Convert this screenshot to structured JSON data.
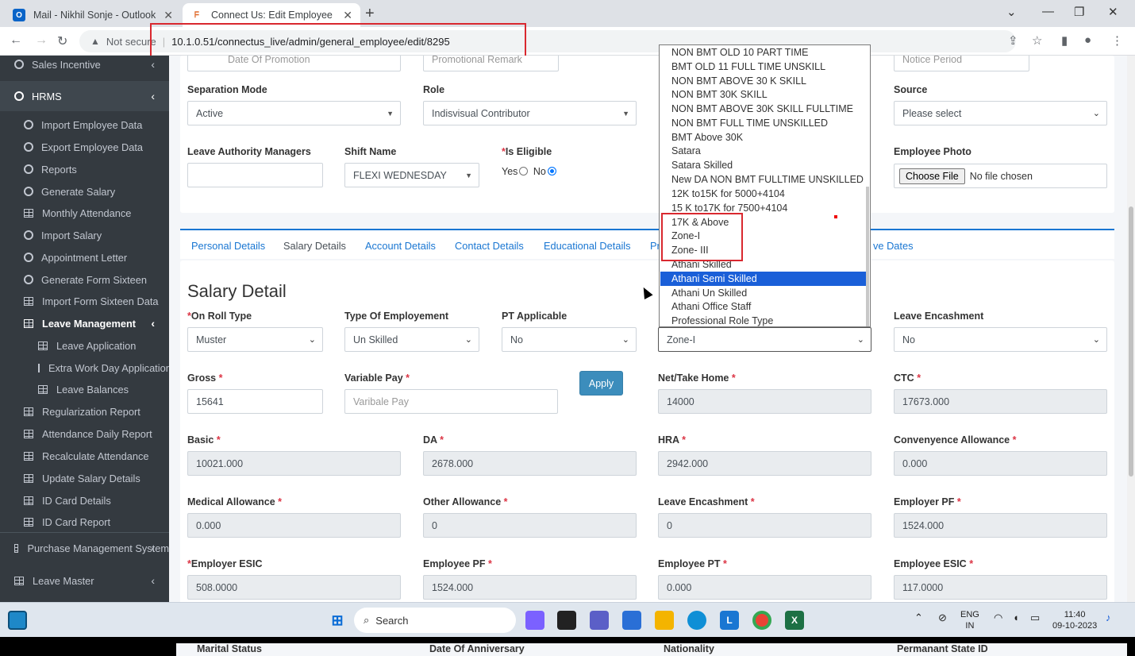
{
  "browser": {
    "tabs": [
      {
        "title": "Mail - Nikhil Sonje - Outlook",
        "icon": "outlook-icon"
      },
      {
        "title": "Connect Us: Edit Employee",
        "icon": "site-favicon"
      }
    ],
    "security": "Not secure",
    "url": "10.1.0.51/connectus_live/admin/general_employee/edit/8295"
  },
  "sidebar": {
    "top_item": "Sales Incentive",
    "hrms": "HRMS",
    "items": [
      "Import Employee Data",
      "Export Employee Data",
      "Reports",
      "Generate Salary",
      "Monthly Attendance",
      "Import Salary",
      "Appointment Letter",
      "Generate Form Sixteen",
      "Import Form Sixteen Data"
    ],
    "leave_management": "Leave Management",
    "leave_sub": [
      "Leave Application",
      "Extra Work Day Application",
      "Leave Balances"
    ],
    "more_items": [
      "Regularization Report",
      "Attendance Daily Report",
      "Recalculate Attendance",
      "Update Salary Details",
      "ID Card Details",
      "ID Card Report"
    ],
    "purchase": "Purchase Management System",
    "leave_master": "Leave Master"
  },
  "top_form": {
    "date_of_promotion_ph": "Date Of Promotion",
    "promotional_remark_ph": "Promotional Remark",
    "notice_period_ph": "Notice Period",
    "separation_mode_label": "Separation Mode",
    "separation_mode_value": "Active",
    "role_label": "Role",
    "role_value": "Indisvisual Contributor",
    "source_label": "Source",
    "source_value": "Please select",
    "leave_authority_label": "Leave Authority Managers",
    "shift_name_label": "Shift Name",
    "shift_name_value": "FLEXI WEDNESDAY",
    "is_eligible_label": "Is Eligible",
    "yes": "Yes",
    "no": "No",
    "employee_photo_label": "Employee Photo",
    "choose_file": "Choose File",
    "no_file": "No file chosen"
  },
  "detail_tabs": [
    "Personal Details",
    "Salary Details",
    "Account Details",
    "Contact Details",
    "Educational Details",
    "Pr",
    "ve Dates"
  ],
  "salary": {
    "heading": "Salary Detail",
    "on_roll_type_label": "On Roll Type",
    "on_roll_type_value": "Muster",
    "type_of_employement_label": "Type Of Employement",
    "type_of_employement_value": "Un Skilled",
    "pt_applicable_label": "PT Applicable",
    "pt_applicable_value": "No",
    "zone_value": "Zone-I",
    "leave_encashment_label": "Leave Encashment",
    "leave_encashment_value": "No",
    "gross_label": "Gross",
    "gross_value": "15641",
    "variable_pay_label": "Variable Pay",
    "variable_pay_ph": "Varibale Pay",
    "apply": "Apply",
    "net_label": "Net/Take Home",
    "net_value": "14000",
    "ctc_label": "CTC",
    "ctc_value": "17673.000",
    "basic_label": "Basic",
    "basic_value": "10021.000",
    "da_label": "DA",
    "da_value": "2678.000",
    "hra_label": "HRA",
    "hra_value": "2942.000",
    "conv_label": "Convenyence Allowance",
    "conv_value": "0.000",
    "medical_label": "Medical Allowance",
    "medical_value": "0.000",
    "other_label": "Other Allowance",
    "other_value": "0",
    "leave_enc_label": "Leave Encashment",
    "leave_enc_value": "0",
    "employer_pf_label": "Employer PF",
    "employer_pf_value": "1524.000",
    "employer_esic_label": "Employer ESIC",
    "employer_esic_value": "508.0000",
    "employee_pf_label": "Employee PF",
    "employee_pf_value": "1524.000",
    "employee_pt_label": "Employee PT",
    "employee_pt_value": "0.000",
    "employee_esic_label": "Employee ESIC",
    "employee_esic_value": "117.0000"
  },
  "dropdown": {
    "options": [
      "NON BMT OLD 10 PART TIME",
      "BMT OLD 11 FULL TIME UNSKILL",
      "NON BMT ABOVE 30 K SKILL",
      "NON BMT 30K SKILL",
      "NON BMT ABOVE 30K SKILL FULLTIME",
      "NON BMT FULL TIME UNSKILLED",
      "BMT Above 30K",
      "Satara",
      "Satara Skilled",
      "New DA NON BMT FULLTIME UNSKILLED",
      "12K to15K for 5000+4104",
      "15 K to17K for 7500+4104",
      "17K & Above",
      "Zone-I",
      "Zone- III",
      "Athani Skilled",
      "Athani Semi Skilled",
      "Athani Un Skilled",
      "Athani Office Staff",
      "Professional Role Type"
    ],
    "highlighted": "Athani Semi Skilled"
  },
  "bottom_labels": [
    "Marital Status",
    "Date Of Anniversary",
    "Nationality",
    "Permanant State ID"
  ],
  "taskbar": {
    "search": "Search",
    "lang1": "ENG",
    "lang2": "IN",
    "time": "11:40",
    "date": "09-10-2023"
  },
  "colors": {
    "primary": "#1976d2",
    "sidebar": "#343a40",
    "highlight": "#1a5fd8",
    "annotation": "#d9282f"
  }
}
